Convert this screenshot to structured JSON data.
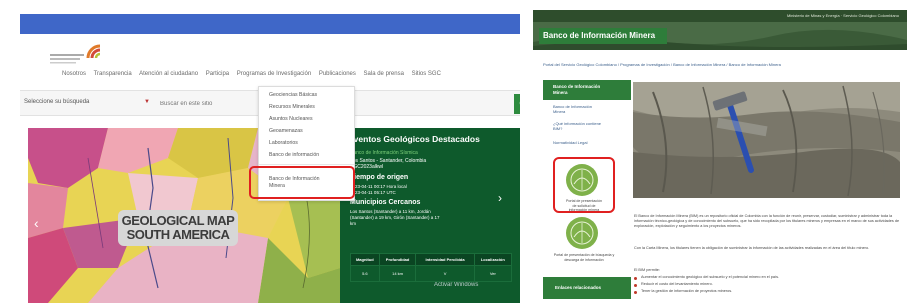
{
  "left": {
    "nav": {
      "items": [
        "Nosotros",
        "Transparencia",
        "Atención al ciudadano",
        "Participa",
        "Programas de Investigación",
        "Publicaciones",
        "Sala de prensa",
        "Sitios SGC"
      ]
    },
    "search": {
      "select_value": "Seleccione su búsqueda",
      "placeholder": "Buscar en este sitio"
    },
    "dropdown": {
      "items": [
        "Geociencias Básicas",
        "Recursos Minerales",
        "Asuntos Nucleares",
        "Geoamenazas",
        "Laboratorios",
        "Banco de información",
        "Banco de Información",
        "Minera"
      ]
    },
    "map": {
      "line1": "GEOLOGICAL MAP",
      "line2": "SOUTH AMERICA"
    },
    "events": {
      "title": "Eventos Geológicos Destacados",
      "subtitle": "Banco de Información Sísmica",
      "loc1": "Los Santos - Santander, Colombia",
      "loc2": "SGC2023alkwl",
      "heading1": "Tiempo de origen",
      "time1": "2023-04-11 00:17 Hora local",
      "time2": "2023-04-11 05:17 UTC",
      "heading2": "Municipios Cercanos",
      "city1": "Los Santos (Santander) a 11 km, Jordán",
      "city2": "(Santander) a 19 km, Girón (Santander) a 17",
      "city3": "km",
      "table_headers": [
        "Magnitud",
        "Profundidad",
        "Intensidad Percibida",
        "Localización"
      ],
      "table_row": [
        "5.6",
        "14 km",
        "V",
        "Ver"
      ]
    },
    "watermark": "Activar Windows"
  },
  "right": {
    "header_toptext": "Ministerio de Minas y Energía · Servicio Geológico Colombiano",
    "title": "Banco de Información Minera",
    "breadcrumb": "Portal del Servicio Geológico Colombiano  /  Programas de Investigación  /  Banco de Información Minera  /  Banco de Información Minera",
    "sidebar": {
      "active_line1": "Banco de Información",
      "active_line2": "Minera",
      "links": [
        "Banco de Información",
        "Minera",
        "¿Qué información contiene",
        "BIM?",
        "Normatividad Legal"
      ],
      "circle1_label1": "Portal de presentación",
      "circle1_label2": "de solicitud de",
      "circle1_label3": "información minera",
      "circle2_label1": "Portal de presentación de búsqueda y",
      "circle2_label2": "descarga de información",
      "bottom_label": "Enlaces relacionados"
    },
    "para1": "El Banco de Información Minera (BIM) es un repositorio oficial de Colombia con la función de reunir, preservar, custodiar, suministrar y administrar toda la información técnico-geológica y de conocimiento del subsuelo, que ha sido recopilada por los titulares mineros y empresas en el marco de sus actividades de exploración, explotación y seguimiento a los proyectos mineros.",
    "para2": "Con la Carta Minera, los titulares tienen la obligación de suministrar la información de las actividades realizadas en el área del título minero.",
    "list_title": "El BIM permite:",
    "list": [
      "Aumentar el conocimiento geológico del subsuelo y el potencial minero en el país.",
      "Reducir el costo del levantamiento minero.",
      "Tener la gestión de información de proyectos mineros."
    ]
  },
  "colors": {
    "sgc_blue": "#3f67c8",
    "sgc_green": "#2e7d3a",
    "dark_green": "#0e5a2c",
    "highlight_red": "#e02020"
  }
}
